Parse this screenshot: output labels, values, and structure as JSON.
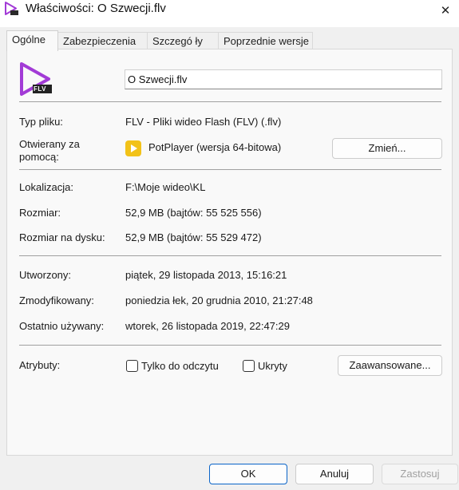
{
  "window": {
    "title": "Właściwości: O Szwecji.flv",
    "close_glyph": "✕"
  },
  "tabs": [
    {
      "label": "Ogólne",
      "active": true
    },
    {
      "label": "Zabezpieczenia",
      "active": false
    },
    {
      "label": "Szczegó ły",
      "active": false
    },
    {
      "label": "Poprzednie wersje",
      "active": false
    }
  ],
  "file": {
    "icon_label": "FLV",
    "name": "O Szwecji.flv"
  },
  "info": {
    "type_label": "Typ pliku:",
    "type_value": "FLV - Pliki wideo Flash (FLV) (.flv)",
    "opens_label_line1": "Otwierany za",
    "opens_label_line2": "pomocą:",
    "opens_value": "PotPlayer (wersja 64-bitowa)",
    "change_button": "Zmień...",
    "location_label": "Lokalizacja:",
    "location_value": "F:\\Moje wideo\\KL",
    "size_label": "Rozmiar:",
    "size_value": "52,9 MB (bajtów: 55 525 556)",
    "disk_size_label": "Rozmiar na dysku:",
    "disk_size_value": "52,9 MB (bajtów: 55 529 472)",
    "created_label": "Utworzony:",
    "created_value": "piątek, 29 listopada 2013, 15:16:21",
    "modified_label": "Zmodyfikowany:",
    "modified_value": "poniedzia łek, 20 grudnia 2010, 21:27:48",
    "accessed_label": "Ostatnio używany:",
    "accessed_value": "wtorek, 26 listopada 2019, 22:47:29"
  },
  "attributes": {
    "label": "Atrybuty:",
    "readonly_label": "Tylko do odczytu",
    "readonly_checked": false,
    "hidden_label": "Ukryty",
    "hidden_checked": false,
    "advanced_button": "Zaawansowane..."
  },
  "footer": {
    "ok": "OK",
    "cancel": "Anuluj",
    "apply": "Zastosuj"
  },
  "colors": {
    "accent": "#0a64c8",
    "flv_purple": "#a23bd6",
    "potplayer_yellow": "#f2c218"
  }
}
